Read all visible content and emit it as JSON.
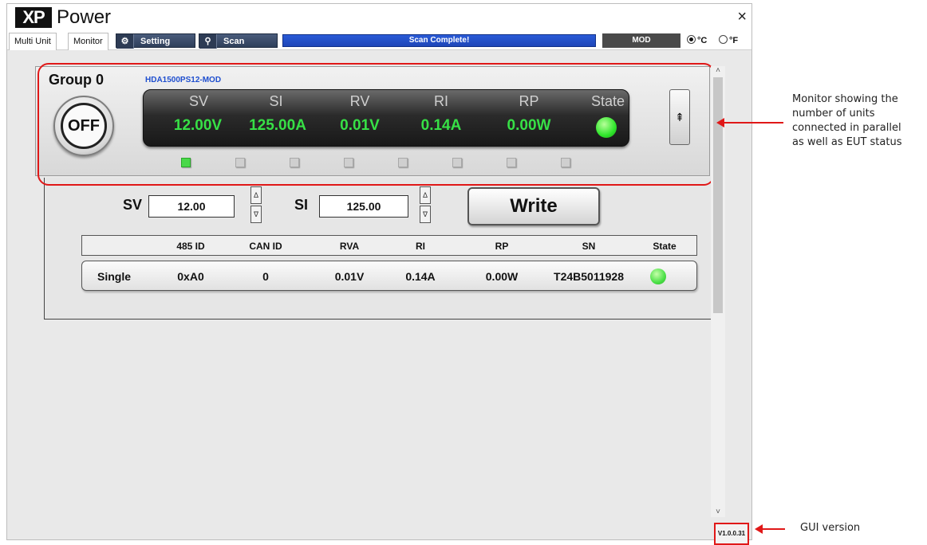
{
  "window": {
    "logo_xp": "XP",
    "logo_power": "Power",
    "close_glyph": "×"
  },
  "toolbar": {
    "tab_multi_unit": "Multi Unit",
    "tab_monitor": "Monitor",
    "setting_label": "Setting",
    "setting_icon": "gear-icon",
    "scan_label": "Scan",
    "scan_icon": "search-icon",
    "scan_status": "Scan Complete!",
    "mode": "MOD",
    "temp_c": "°C",
    "temp_f": "°F",
    "temp_selected": "°C"
  },
  "group": {
    "title": "Group 0",
    "model": "HDA1500PS12-MOD",
    "power_button": "OFF",
    "display": {
      "headers": [
        "SV",
        "SI",
        "RV",
        "RI",
        "RP",
        "State"
      ],
      "values": [
        "12.00V",
        "125.00A",
        "0.01V",
        "0.14A",
        "0.00W"
      ],
      "state_color": "#2fe52b"
    },
    "units": [
      true,
      false,
      false,
      false,
      false,
      false,
      false,
      false
    ]
  },
  "write_panel": {
    "sv_label": "SV",
    "sv_value": "12.00",
    "si_label": "SI",
    "si_value": "125.00",
    "spin_up": "Δ",
    "spin_down": "∇",
    "write_button": "Write"
  },
  "table": {
    "headers": [
      "485 ID",
      "CAN ID",
      "RVA",
      "RI",
      "RP",
      "SN",
      "State"
    ],
    "rows": [
      {
        "name": "Single",
        "id485": "0xA0",
        "can_id": "0",
        "rva": "0.01V",
        "ri": "0.14A",
        "rp": "0.00W",
        "sn": "T24B5011928",
        "state_color": "#4ae046"
      }
    ]
  },
  "version": "V1.0.0.31",
  "annotations": {
    "monitor_note": [
      "Monitor showing the",
      "number of units",
      "connected in parallel",
      "as well as EUT status"
    ],
    "gui_version_note": "GUI version"
  },
  "colors": {
    "accent_red": "#e01818",
    "scan_blue": "#1e46b8",
    "led_green": "#2fe52b"
  }
}
